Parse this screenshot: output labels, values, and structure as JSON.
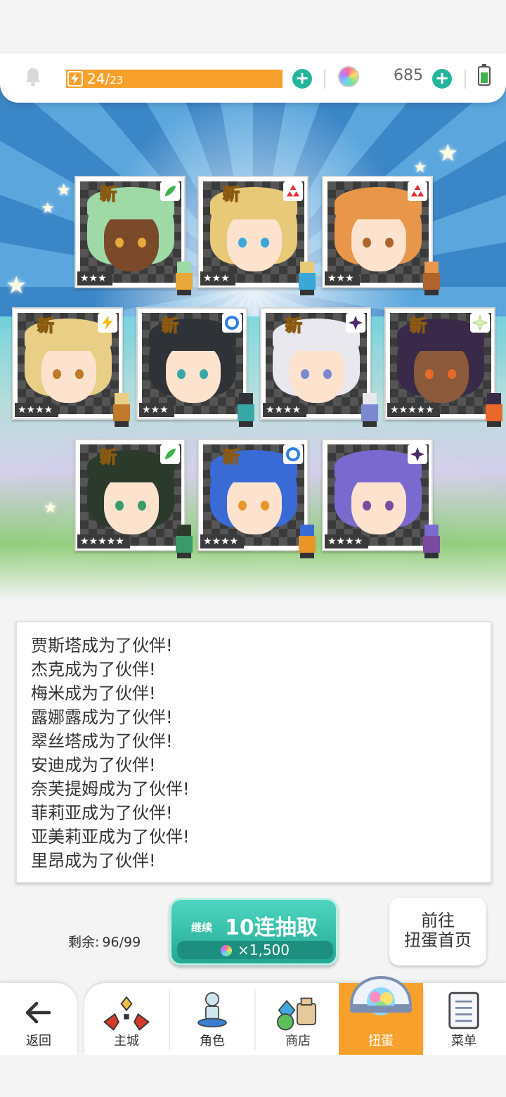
{
  "status_bar": {
    "stamina_current": "24",
    "stamina_max": "23",
    "gem_count": "685"
  },
  "cards": [
    {
      "new": "新",
      "rarity": "★★★",
      "element": "leaf",
      "hair": "#9fd9a6",
      "skin": "#7a4a2a",
      "eye": "#e8a83a"
    },
    {
      "new": "新",
      "rarity": "★★★",
      "element": "fire",
      "hair": "#e8c978",
      "skin": "#fde3cd",
      "eye": "#3aa7d6"
    },
    {
      "new": "",
      "rarity": "★★★",
      "element": "fire",
      "hair": "#e8964a",
      "skin": "#fde3cd",
      "eye": "#b0642b"
    },
    {
      "new": "新",
      "rarity": "★★★★",
      "element": "thunder",
      "hair": "#e9cf86",
      "skin": "#fde3cd",
      "eye": "#c07a2a"
    },
    {
      "new": "新",
      "rarity": "★★★",
      "element": "water",
      "hair": "#2f3338",
      "skin": "#fde3cd",
      "eye": "#3aa7a7"
    },
    {
      "new": "新",
      "rarity": "★★★★",
      "element": "dark",
      "hair": "#e8e8ee",
      "skin": "#fde3cd",
      "eye": "#7b8ad0"
    },
    {
      "new": "新",
      "rarity": "★★★★★",
      "element": "light",
      "hair": "#3a2a4a",
      "skin": "#8a5a3a",
      "eye": "#e86a2a"
    },
    {
      "new": "新",
      "rarity": "★★★★★",
      "element": "leaf",
      "hair": "#2c3a2c",
      "skin": "#fde3cd",
      "eye": "#3a9a6a"
    },
    {
      "new": "新",
      "rarity": "★★★★",
      "element": "water",
      "hair": "#3a6ad6",
      "skin": "#fde3cd",
      "eye": "#e8962a"
    },
    {
      "new": "",
      "rarity": "★★★★",
      "element": "dark",
      "hair": "#7a6ad0",
      "skin": "#fde3cd",
      "eye": "#7a4aa0"
    }
  ],
  "log": {
    "lines": [
      "贾斯塔成为了伙伴!",
      "杰克成为了伙伴!",
      "梅米成为了伙伴!",
      "露娜露成为了伙伴!",
      "翠丝塔成为了伙伴!",
      "安迪成为了伙伴!",
      "奈芙提姆成为了伙伴!",
      "菲莉亚成为了伙伴!",
      "亚美莉亚成为了伙伴!",
      "里昂成为了伙伴!"
    ]
  },
  "gacha": {
    "remaining_label": "剩余:",
    "remaining_value": "96/99",
    "continue_label": "继续",
    "main_label": "10连抽取",
    "cost": "×1,500",
    "home_line1": "前往",
    "home_line2": "扭蛋首页"
  },
  "nav": {
    "back": "返回",
    "tabs": [
      "主城",
      "角色",
      "商店",
      "扭蛋",
      "菜单"
    ],
    "active_tab": "扭蛋"
  },
  "colors": {
    "accent_orange": "#f7a12c",
    "accent_teal": "#23b59c",
    "sky_blue": "#3b86c7"
  }
}
